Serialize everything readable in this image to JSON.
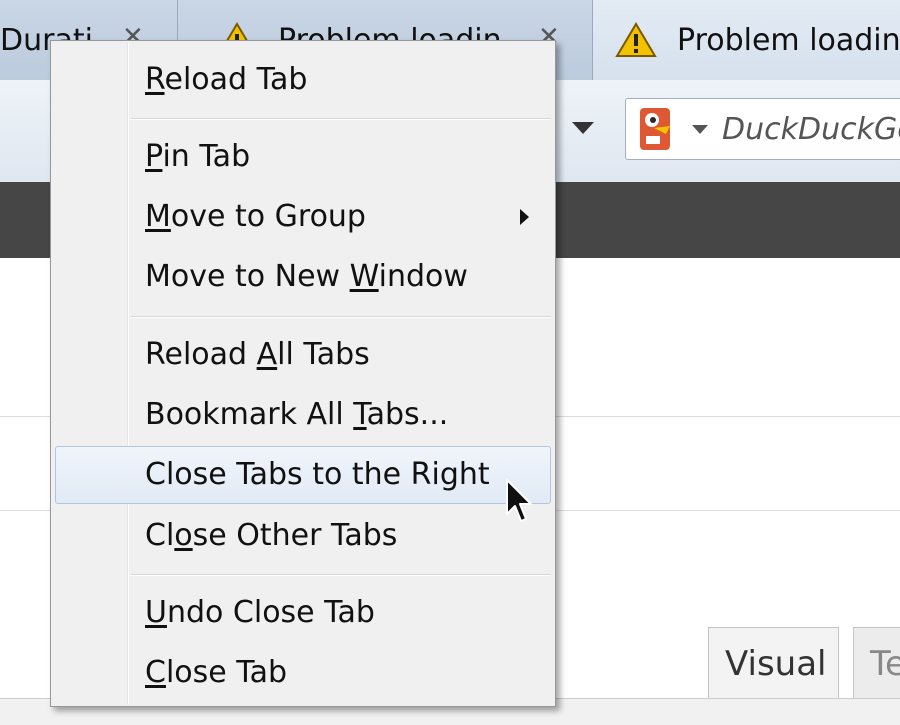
{
  "tabs": [
    {
      "label": "Durati",
      "close_glyph": "✕"
    },
    {
      "label": "Problem loadin",
      "close_glyph": "✕",
      "icon": "warning-icon"
    },
    {
      "label": "Problem loadin",
      "icon": "warning-icon"
    }
  ],
  "search": {
    "placeholder": "DuckDuckGo",
    "engine_icon": "duckduckgo-icon"
  },
  "editor_tabs": {
    "visual": "Visual",
    "text": "Te"
  },
  "context_menu": {
    "reload_tab": {
      "pre": "",
      "key": "R",
      "post": "eload Tab"
    },
    "pin_tab": {
      "pre": "",
      "key": "P",
      "post": "in Tab"
    },
    "move_to_group": {
      "pre": "",
      "key": "M",
      "post": "ove to Group"
    },
    "move_to_new_window": {
      "pre": "Move to New ",
      "key": "W",
      "post": "indow"
    },
    "reload_all_tabs": {
      "pre": "Reload ",
      "key": "A",
      "post": "ll Tabs"
    },
    "bookmark_all_tabs": {
      "pre": "Bookmark All ",
      "key": "T",
      "post": "abs..."
    },
    "close_tabs_right": {
      "pre": "Close Tabs to the Right",
      "key": "",
      "post": ""
    },
    "close_other_tabs": {
      "pre": "Cl",
      "key": "o",
      "post": "se Other Tabs"
    },
    "undo_close_tab": {
      "pre": "",
      "key": "U",
      "post": "ndo Close Tab"
    },
    "close_tab": {
      "pre": "",
      "key": "C",
      "post": "lose Tab"
    }
  },
  "colors": {
    "menu_bg": "#f0f0f0",
    "hover_border": "#b2c6e0",
    "toolbar_dark": "#464646",
    "warning": "#f2c200"
  }
}
